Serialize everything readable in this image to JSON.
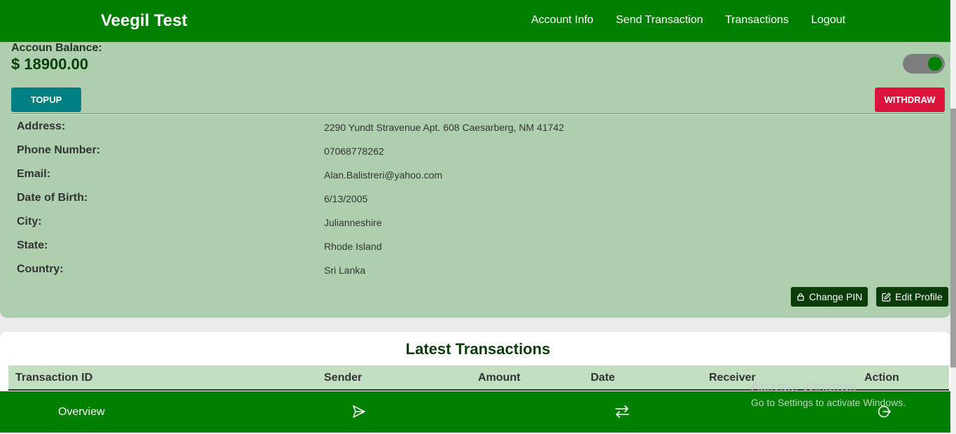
{
  "brand": "Veegil Test",
  "nav": {
    "account_info": "Account Info",
    "send_transaction": "Send Transaction",
    "transactions": "Transactions",
    "logout": "Logout"
  },
  "account": {
    "balance_label": "Accoun Balance:",
    "balance_value": "$ 18900.00",
    "toggle_on": true,
    "topup_label": "TOPUP",
    "withdraw_label": "WITHDRAW",
    "details": [
      {
        "label": "Address:",
        "value": "2290 Yundt Stravenue Apt. 608 Caesarberg, NM 41742"
      },
      {
        "label": "Phone Number:",
        "value": "07068778262"
      },
      {
        "label": "Email:",
        "value": "Alan.Balistreri@yahoo.com"
      },
      {
        "label": "Date of Birth:",
        "value": "6/13/2005"
      },
      {
        "label": "City:",
        "value": "Julianneshire"
      },
      {
        "label": "State:",
        "value": "Rhode Island"
      },
      {
        "label": "Country:",
        "value": "Sri Lanka"
      }
    ],
    "change_pin_label": "Change PIN",
    "edit_profile_label": "Edit Profile"
  },
  "transactions": {
    "title": "Latest Transactions",
    "columns": [
      "Transaction ID",
      "Sender",
      "Amount",
      "Date",
      "Receiver",
      "Action"
    ]
  },
  "bottom_nav": {
    "overview_label": "Overview",
    "icons": [
      "send-icon",
      "transfer-arrows-icon",
      "logout-icon"
    ]
  },
  "watermark": {
    "title": "Activate Windows",
    "subtitle": "Go to Settings to activate Windows."
  },
  "colors": {
    "primary_green": "#008000",
    "card_green": "#aecfae",
    "header_green": "#c2dfc2",
    "dark_green": "#0a3d0a",
    "teal": "#008080",
    "crimson": "#dc143c"
  }
}
